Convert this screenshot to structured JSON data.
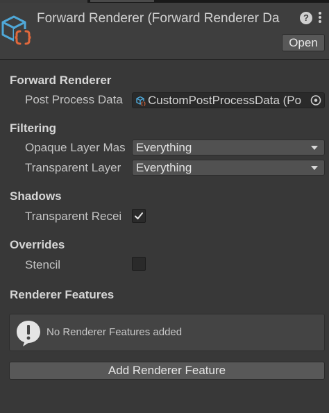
{
  "header": {
    "title": "Forward Renderer (Forward Renderer Da",
    "help_icon": "question-mark-icon",
    "more_icon": "kebab-menu-icon",
    "open_label": "Open",
    "asset_icon": "scriptable-object-cube-icon"
  },
  "sections": {
    "forward_renderer": {
      "header": "Forward Renderer",
      "post_process_label": "Post Process Data",
      "post_process_value": "CustomPostProcessData (Po",
      "post_process_icon": "scriptable-object-icon",
      "picker_icon": "object-picker-icon"
    },
    "filtering": {
      "header": "Filtering",
      "opaque_label": "Opaque Layer Mas",
      "opaque_value": "Everything",
      "transparent_label": "Transparent Layer",
      "transparent_value": "Everything"
    },
    "shadows": {
      "header": "Shadows",
      "transparent_receive_label": "Transparent Recei",
      "transparent_receive_checked": true
    },
    "overrides": {
      "header": "Overrides",
      "stencil_label": "Stencil",
      "stencil_checked": false
    },
    "renderer_features": {
      "header": "Renderer Features",
      "empty_message": "No Renderer Features added",
      "warning_icon": "exclamation-speech-bubble-icon",
      "add_button_label": "Add Renderer Feature"
    }
  },
  "colors": {
    "background": "#383838",
    "asset_icon_blue": "#4fa8d8",
    "asset_icon_orange": "#e0683c"
  }
}
